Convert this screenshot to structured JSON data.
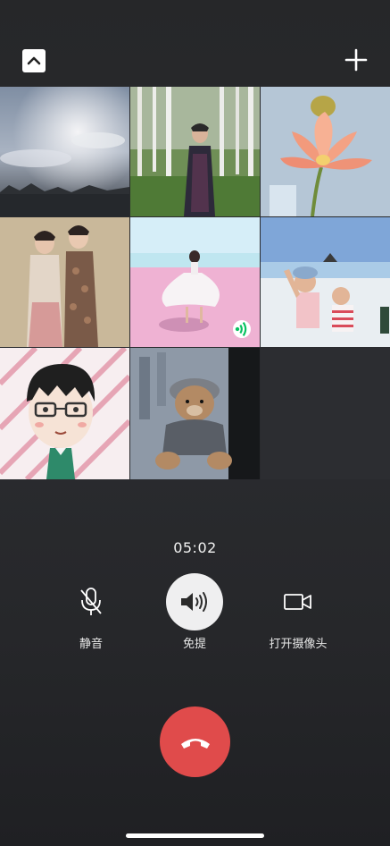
{
  "header": {
    "collapse_icon": "chevron-up-icon",
    "add_icon": "plus-icon"
  },
  "participants": [
    {
      "id": "p1",
      "photo": "sky-clouds-landscape"
    },
    {
      "id": "p2",
      "photo": "woman-in-birch-forest"
    },
    {
      "id": "p3",
      "photo": "pink-lotus-flower"
    },
    {
      "id": "p4",
      "photo": "two-women-in-qipao"
    },
    {
      "id": "p5",
      "photo": "dancer-on-pink-beach",
      "speaking": true
    },
    {
      "id": "p6",
      "photo": "children-by-salt-lake"
    },
    {
      "id": "p7",
      "photo": "cartoon-avatar-with-glasses"
    },
    {
      "id": "p8",
      "photo": "teddy-bear-by-window"
    }
  ],
  "call": {
    "duration": "05:02"
  },
  "controls": {
    "mute_label": "静音",
    "speaker_label": "免提",
    "camera_label": "打开摄像头"
  },
  "colors": {
    "background": "#26272a",
    "hangup": "#e04b4b",
    "speaking": "#07c160"
  }
}
